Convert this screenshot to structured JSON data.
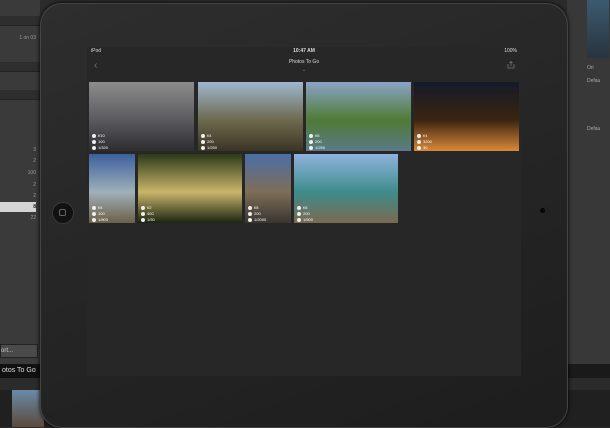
{
  "app": {
    "left_rows": [
      "1 on 03"
    ],
    "left_values": [
      "3",
      "2",
      "100",
      "2",
      "2",
      "8",
      "22"
    ],
    "export_button_label": "ort...",
    "filmstrip_tab_label": "otos To Go",
    "right_labels": [
      "Ori",
      "Defau",
      "Defau"
    ]
  },
  "device": {
    "status": {
      "carrier": "iPod",
      "time": "10:47 AM",
      "battery": "100%"
    },
    "nav": {
      "title": "Photos To Go"
    }
  },
  "photos": [
    {
      "f": "f/10",
      "iso": "100",
      "ss": "1/320",
      "colors": [
        "#8c8c8c",
        "#5b5b5f",
        "#2d2d30"
      ]
    },
    {
      "f": "f/4",
      "iso": "200",
      "ss": "1/250",
      "colors": [
        "#9eb7cf",
        "#6d6a4e",
        "#3a3524"
      ]
    },
    {
      "f": "f/8",
      "iso": "200",
      "ss": "1/250",
      "colors": [
        "#8aa4c7",
        "#4f7a35",
        "#5a7a88"
      ]
    },
    {
      "f": "f/4",
      "iso": "3200",
      "ss": "30",
      "colors": [
        "#141a2a",
        "#3a2410",
        "#d9893a"
      ]
    },
    {
      "f": "f/4",
      "iso": "100",
      "ss": "1/800",
      "colors": [
        "#3c5f9e",
        "#a0b0b8",
        "#6d6048"
      ]
    },
    {
      "f": "f/2",
      "iso": "400",
      "ss": "1/50",
      "colors": [
        "#2c3a18",
        "#c9b56a",
        "#1c2410"
      ]
    },
    {
      "f": "f/8",
      "iso": "200",
      "ss": "1/2000",
      "colors": [
        "#4a6fa6",
        "#7e6e58",
        "#3a3530"
      ]
    },
    {
      "f": "f/8",
      "iso": "200",
      "ss": "1/500",
      "colors": [
        "#8fb3de",
        "#3e8c8a",
        "#7a6a50"
      ]
    }
  ]
}
